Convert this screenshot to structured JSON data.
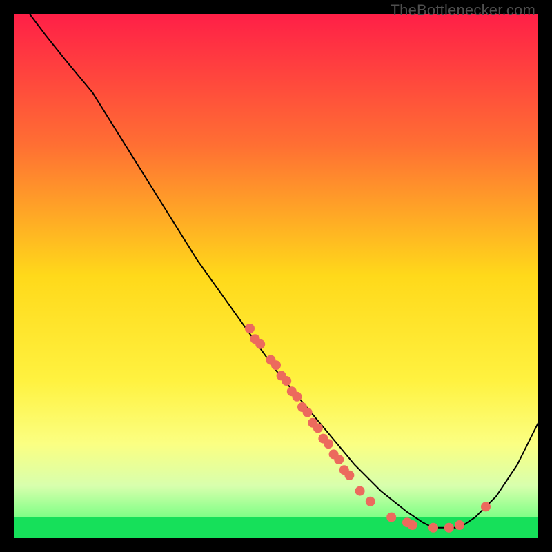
{
  "watermark": "TheBottlenecker.com",
  "chart_data": {
    "type": "line",
    "title": "",
    "xlabel": "",
    "ylabel": "",
    "xlim": [
      0,
      100
    ],
    "ylim": [
      0,
      100
    ],
    "grid": false,
    "background_gradient": {
      "stops": [
        {
          "offset": 0.0,
          "color": "#ff1f47"
        },
        {
          "offset": 0.25,
          "color": "#ff6f33"
        },
        {
          "offset": 0.5,
          "color": "#ffd91a"
        },
        {
          "offset": 0.7,
          "color": "#fff240"
        },
        {
          "offset": 0.82,
          "color": "#fbff82"
        },
        {
          "offset": 0.9,
          "color": "#d8ffad"
        },
        {
          "offset": 0.96,
          "color": "#7fff86"
        },
        {
          "offset": 1.0,
          "color": "#12d457"
        }
      ]
    },
    "green_band": {
      "y_top": 96,
      "y_bottom": 100
    },
    "series": [
      {
        "name": "bottleneck-curve",
        "color": "#000000",
        "stroke_width": 2,
        "x": [
          3,
          6,
          10,
          15,
          20,
          25,
          30,
          35,
          40,
          45,
          50,
          55,
          60,
          65,
          70,
          75,
          78,
          80,
          82,
          85,
          88,
          92,
          96,
          100
        ],
        "y": [
          0,
          4,
          9,
          15,
          23,
          31,
          39,
          47,
          54,
          61,
          68,
          74,
          80,
          86,
          91,
          95,
          97,
          98,
          98,
          98,
          96,
          92,
          86,
          78
        ]
      }
    ],
    "scatter": {
      "name": "sample-points",
      "color": "#ec6a5d",
      "radius": 7,
      "points": [
        {
          "x": 45,
          "y": 60
        },
        {
          "x": 46,
          "y": 62
        },
        {
          "x": 47,
          "y": 63
        },
        {
          "x": 49,
          "y": 66
        },
        {
          "x": 50,
          "y": 67
        },
        {
          "x": 51,
          "y": 69
        },
        {
          "x": 52,
          "y": 70
        },
        {
          "x": 53,
          "y": 72
        },
        {
          "x": 54,
          "y": 73
        },
        {
          "x": 55,
          "y": 75
        },
        {
          "x": 56,
          "y": 76
        },
        {
          "x": 57,
          "y": 78
        },
        {
          "x": 58,
          "y": 79
        },
        {
          "x": 59,
          "y": 81
        },
        {
          "x": 60,
          "y": 82
        },
        {
          "x": 61,
          "y": 84
        },
        {
          "x": 62,
          "y": 85
        },
        {
          "x": 63,
          "y": 87
        },
        {
          "x": 64,
          "y": 88
        },
        {
          "x": 66,
          "y": 91
        },
        {
          "x": 68,
          "y": 93
        },
        {
          "x": 72,
          "y": 96
        },
        {
          "x": 75,
          "y": 97
        },
        {
          "x": 76,
          "y": 97.5
        },
        {
          "x": 80,
          "y": 98
        },
        {
          "x": 83,
          "y": 98
        },
        {
          "x": 85,
          "y": 97.5
        },
        {
          "x": 90,
          "y": 94
        }
      ]
    }
  }
}
